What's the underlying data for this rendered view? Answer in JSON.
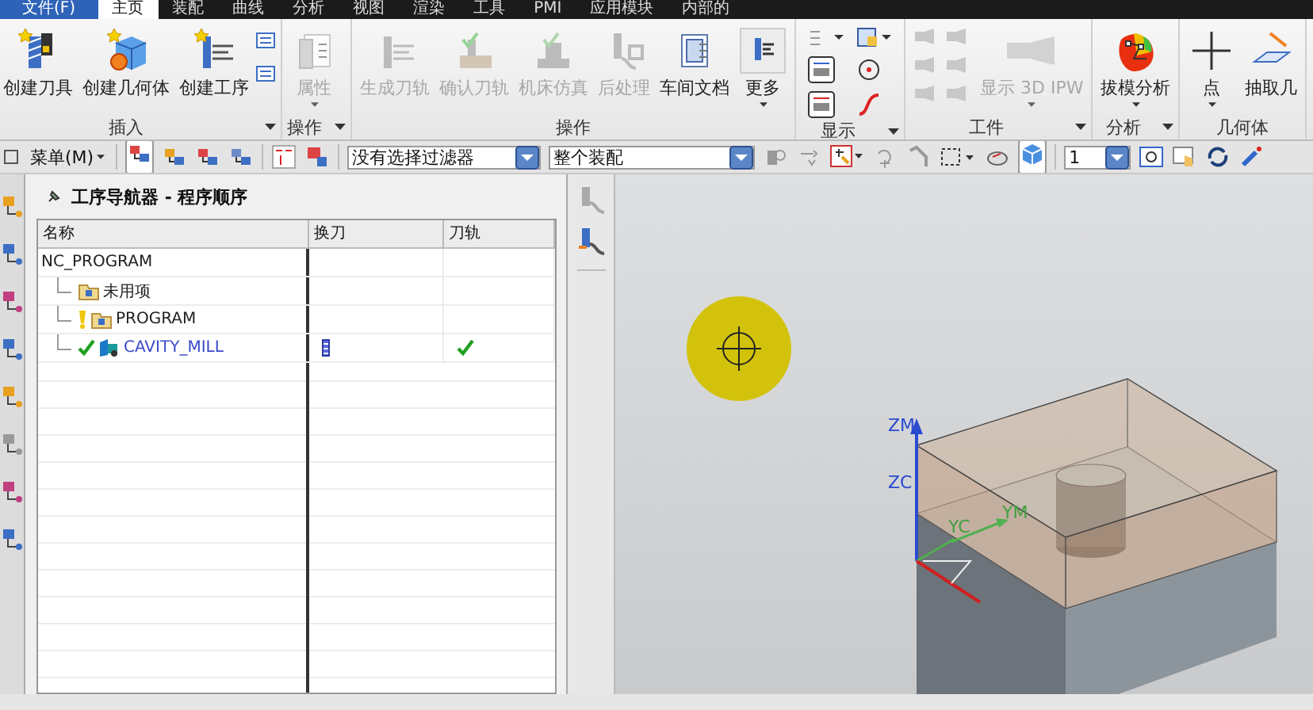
{
  "menu_tabs": [
    {
      "label": "文件(F)",
      "selected": false,
      "kind": "file"
    },
    {
      "label": "主页",
      "selected": true,
      "kind": "tab"
    },
    {
      "label": "装配",
      "selected": false,
      "kind": "tab"
    },
    {
      "label": "曲线",
      "selected": false,
      "kind": "tab"
    },
    {
      "label": "分析",
      "selected": false,
      "kind": "tab"
    },
    {
      "label": "视图",
      "selected": false,
      "kind": "tab"
    },
    {
      "label": "渲染",
      "selected": false,
      "kind": "tab"
    },
    {
      "label": "工具",
      "selected": false,
      "kind": "tab"
    },
    {
      "label": "PMI",
      "selected": false,
      "kind": "tab"
    },
    {
      "label": "应用模块",
      "selected": false,
      "kind": "tab"
    },
    {
      "label": "内部的",
      "selected": false,
      "kind": "tab"
    }
  ],
  "ribbon_groups": [
    {
      "label": "插入",
      "menu": true,
      "kind": "insert",
      "buttons": [
        {
          "label": "创建刀具",
          "disabled": false,
          "dropdown": false
        },
        {
          "label": "创建几何体",
          "disabled": false,
          "dropdown": false
        },
        {
          "label": "创建工序",
          "disabled": false,
          "dropdown": false
        }
      ]
    },
    {
      "label": "操作",
      "menu": true,
      "kind": "plain",
      "buttons": [
        {
          "label": "属性",
          "disabled": true,
          "dropdown": true
        }
      ]
    },
    {
      "label": "操作",
      "menu": false,
      "kind": "plain",
      "buttons": [
        {
          "label": "生成刀轨",
          "disabled": true,
          "dropdown": false
        },
        {
          "label": "确认刀轨",
          "disabled": true,
          "dropdown": false
        },
        {
          "label": "机床仿真",
          "disabled": true,
          "dropdown": false
        },
        {
          "label": "后处理",
          "disabled": true,
          "dropdown": false
        },
        {
          "label": "车间文档",
          "disabled": false,
          "dropdown": false
        },
        {
          "label": "更多",
          "disabled": false,
          "dropdown": true
        }
      ]
    },
    {
      "label": "显示",
      "menu": true,
      "kind": "display"
    },
    {
      "label": "工件",
      "menu": true,
      "kind": "workpiece",
      "buttons": [
        {
          "label": "显示 3D IPW",
          "disabled": true,
          "dropdown": true
        }
      ]
    },
    {
      "label": "分析",
      "menu": true,
      "kind": "plain",
      "buttons": [
        {
          "label": "拔模分析",
          "disabled": false,
          "dropdown": true
        }
      ]
    },
    {
      "label": "几何体",
      "menu": false,
      "kind": "plain",
      "buttons": [
        {
          "label": "点",
          "disabled": false,
          "dropdown": true
        },
        {
          "label": "抽取几",
          "disabled": false,
          "dropdown": false
        }
      ]
    }
  ],
  "toolbar": {
    "menu_button": "菜单(M)",
    "type_filter": "没有选择过滤器",
    "scope": "整个装配",
    "layer": "1"
  },
  "navigator": {
    "title": "工序导航器 - 程序顺序",
    "columns": [
      "名称",
      "换刀",
      "刀轨"
    ],
    "rows": [
      {
        "name": "NC_PROGRAM",
        "warning": false,
        "complete": false,
        "tool_change": false,
        "toolpath_complete": false,
        "children": [
          {
            "name": "未用项",
            "kind": "folder",
            "warning": false,
            "complete": false,
            "tool_change": false,
            "toolpath_complete": false
          },
          {
            "name": "PROGRAM",
            "kind": "folder",
            "warning": true,
            "complete": false,
            "tool_change": false,
            "toolpath_complete": false
          },
          {
            "name": "CAVITY_MILL",
            "kind": "operation",
            "warning": false,
            "complete": true,
            "tool_change": true,
            "toolpath_complete": true
          }
        ]
      }
    ]
  },
  "viewport": {
    "axis_labels": [
      {
        "text": "ZM",
        "kind": "z"
      },
      {
        "text": "ZC",
        "kind": "z"
      },
      {
        "text": "YC",
        "kind": "y"
      },
      {
        "text": "YM",
        "kind": "y"
      }
    ]
  }
}
